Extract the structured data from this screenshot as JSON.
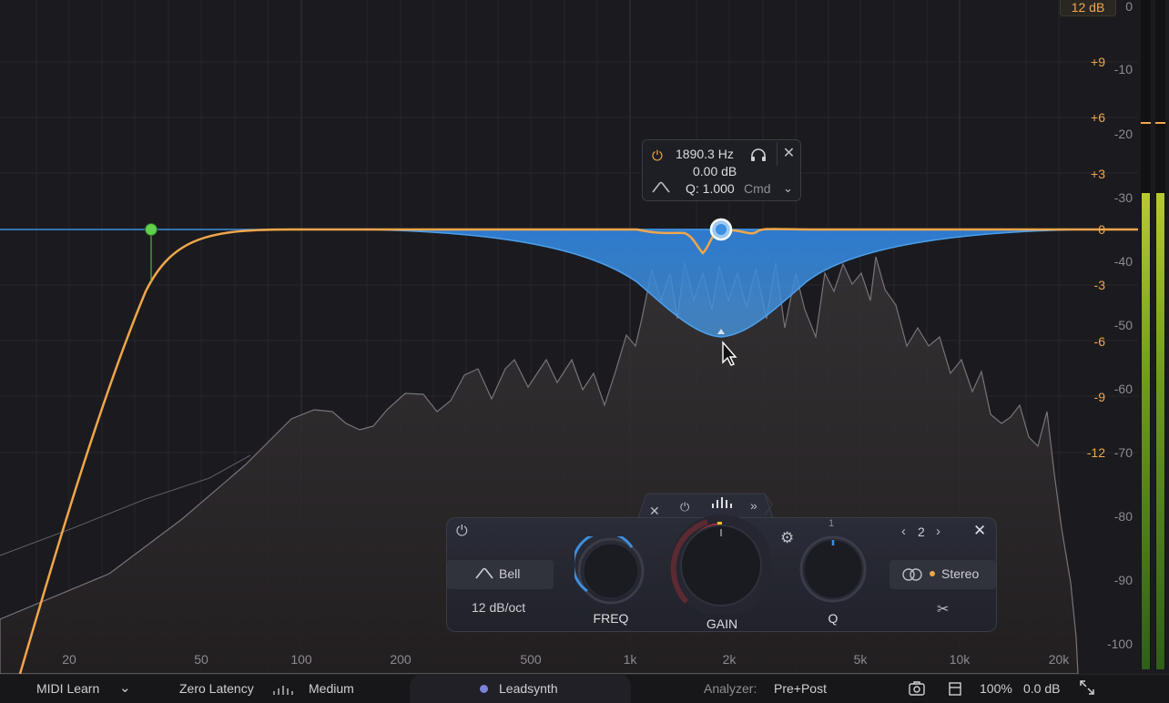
{
  "gain_scale": [
    "12 dB",
    "+9",
    "+6",
    "+3",
    "0",
    "-3",
    "-6",
    "-9",
    "-12"
  ],
  "meter_scale": [
    "0",
    "-10",
    "-20",
    "-30",
    "-40",
    "-50",
    "-60",
    "-70",
    "-80",
    "-90",
    "-100"
  ],
  "freq_axis": [
    "20",
    "50",
    "100",
    "200",
    "500",
    "1k",
    "2k",
    "5k",
    "10k",
    "20k"
  ],
  "tooltip": {
    "frequency": "1890.3 Hz",
    "gain": "0.00 dB",
    "q_label": "Q: 1.000",
    "modifier": "Cmd",
    "close": "✕"
  },
  "band_panel": {
    "shape": "Bell",
    "slope": "12 dB/oct",
    "freq_label": "FREQ",
    "gain_label": "GAIN",
    "q_label": "Q",
    "q_marker": "1",
    "band_number": "2",
    "channel": "Stereo",
    "close": "✕"
  },
  "bottom_bar": {
    "midi_learn": "MIDI Learn",
    "latency": "Zero Latency",
    "quality": "Medium",
    "instance": "Leadsynth",
    "analyzer_label": "Analyzer:",
    "analyzer_value": "Pre+Post",
    "zoom": "100%",
    "output_gain": "0.0 dB"
  },
  "colors": {
    "accent_gold": "#f1a64a",
    "accent_blue": "#3d8fe0",
    "node_green": "#5fd14a",
    "meter_green": "#8fb62a"
  }
}
